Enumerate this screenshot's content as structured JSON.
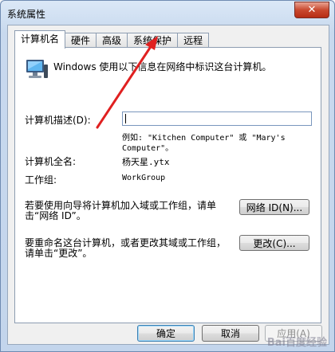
{
  "window": {
    "title": "系统属性",
    "close_label": "✕"
  },
  "tabs": [
    {
      "label": "计算机名",
      "active": true
    },
    {
      "label": "硬件"
    },
    {
      "label": "高级"
    },
    {
      "label": "系统保护"
    },
    {
      "label": "远程"
    }
  ],
  "computer_name_tab": {
    "intro_text": "Windows 使用以下信息在网络中标识这台计算机。",
    "description_label": "计算机描述(D):",
    "description_value": "",
    "example_text_1": "例如: \"Kitchen Computer\" 或 \"Mary's",
    "example_text_2": "Computer\"。",
    "full_name_label": "计算机全名:",
    "full_name_value": "杨天星.ytx",
    "workgroup_label": "工作组:",
    "workgroup_value": "WorkGroup",
    "network_id_text_1": "若要使用向导将计算机加入域或工作组，请单",
    "network_id_text_2": "击“网络 ID”。",
    "network_id_button": "网络 ID(N)...",
    "rename_text_1": "要重命名这台计算机，或者更改其域或工作组，",
    "rename_text_2": "请单击“更改”。",
    "change_button": "更改(C)..."
  },
  "footer": {
    "ok_button": "确定",
    "cancel_button": "取消",
    "apply_button": "应用(A)"
  },
  "colors": {
    "annotation_arrow": "#e02020"
  }
}
